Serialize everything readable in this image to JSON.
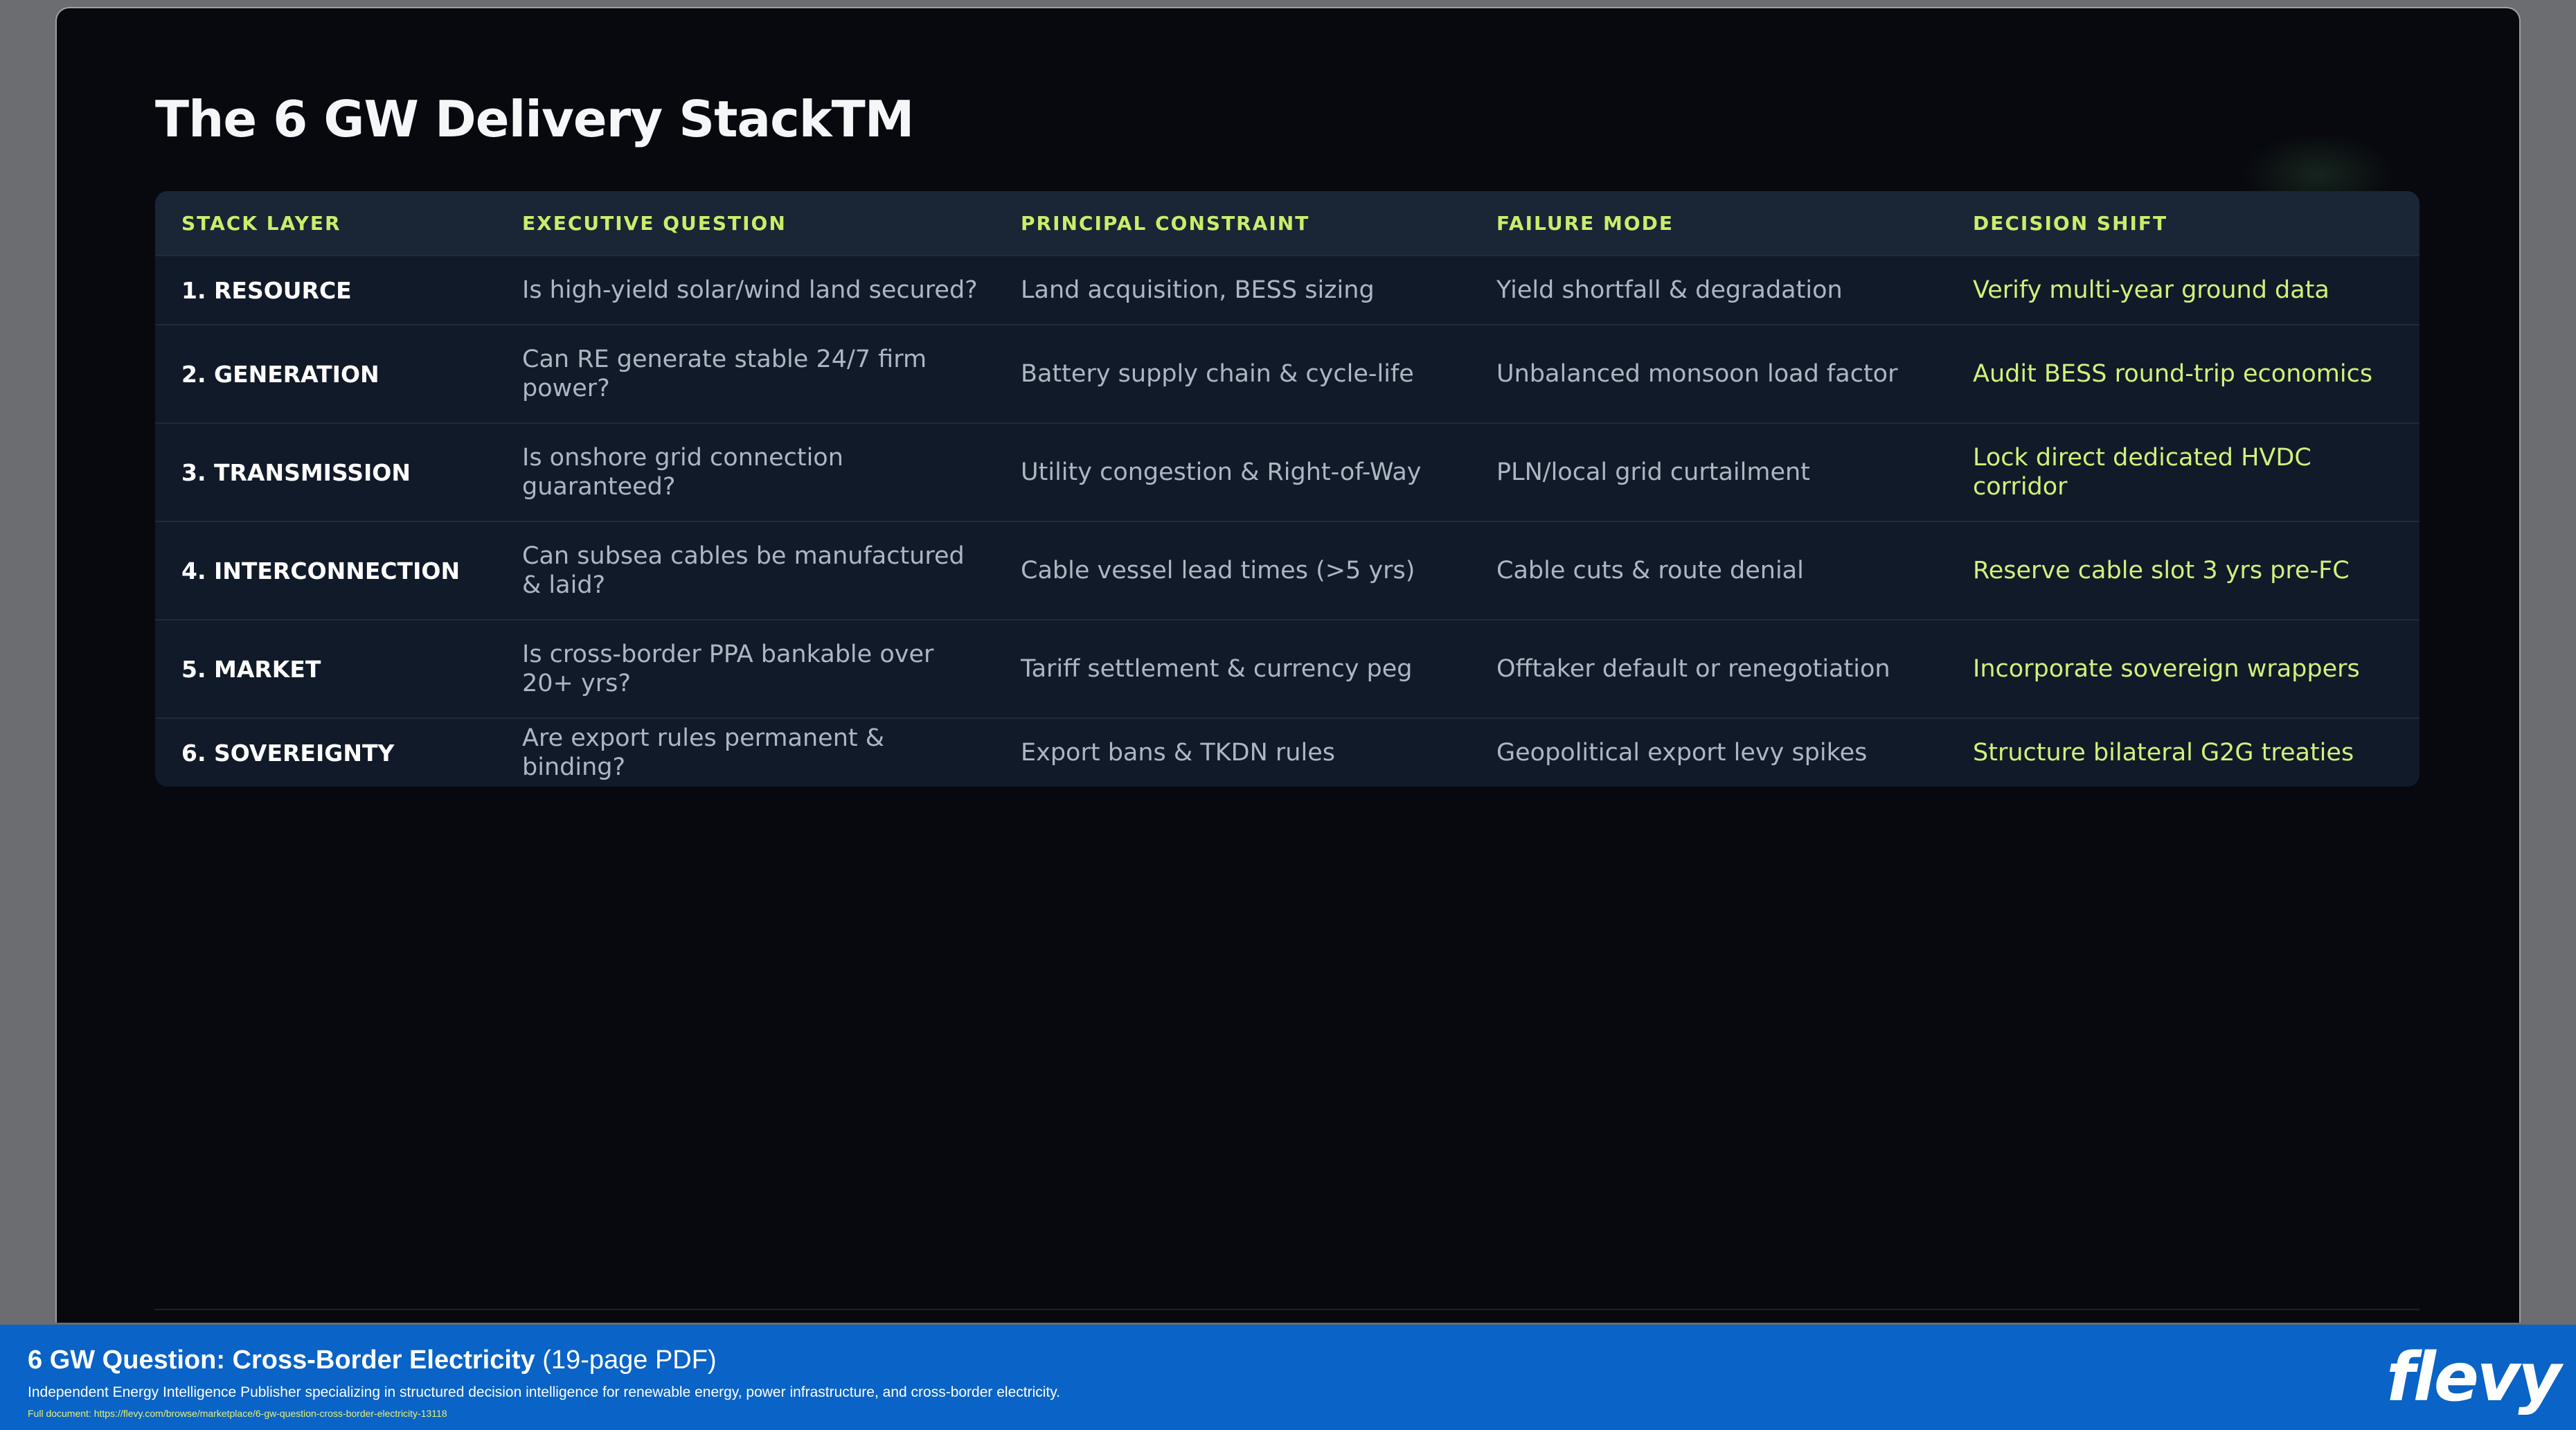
{
  "slide": {
    "title": "The 6 GW Delivery StackTM"
  },
  "table": {
    "headers": [
      "STACK LAYER",
      "EXECUTIVE QUESTION",
      "PRINCIPAL CONSTRAINT",
      "FAILURE MODE",
      "DECISION SHIFT"
    ],
    "rows": [
      [
        "1. RESOURCE",
        "Is high-yield solar/wind land secured?",
        "Land acquisition, BESS sizing",
        "Yield shortfall & degradation",
        "Verify multi-year ground data"
      ],
      [
        "2. GENERATION",
        "Can RE generate stable 24/7 firm power?",
        "Battery supply chain & cycle-life",
        "Unbalanced monsoon load factor",
        "Audit BESS round-trip economics"
      ],
      [
        "3. TRANSMISSION",
        "Is onshore grid connection guaranteed?",
        "Utility congestion & Right-of-Way",
        "PLN/local grid curtailment",
        "Lock direct dedicated HVDC corridor"
      ],
      [
        "4. INTERCONNECTION",
        "Can subsea cables be manufactured & laid?",
        "Cable vessel lead times (>5 yrs)",
        "Cable cuts & route denial",
        "Reserve cable slot 3 yrs pre-FC"
      ],
      [
        "5. MARKET",
        "Is cross-border PPA bankable over 20+ yrs?",
        "Tariff settlement & currency peg",
        "Offtaker default or renegotiation",
        "Incorporate sovereign wrappers"
      ],
      [
        "6. SOVEREIGNTY",
        "Are export rules permanent & binding?",
        "Export bans & TKDN rules",
        "Geopolitical export levy spikes",
        "Structure bilateral G2G treaties"
      ]
    ]
  },
  "banner": {
    "title_strong": "6 GW Question: Cross-Border Electricity",
    "title_suffix": " (19-page PDF)",
    "description": "Independent Energy Intelligence Publisher specializing in structured decision intelligence for renewable energy, power infrastructure, and cross-border electricity.",
    "url": "Full document: https://flevy.com/browse/marketplace/6-gw-question-cross-border-electricity-13118",
    "logo": "flevy"
  },
  "colors": {
    "background": "#07090f",
    "table_bg": "#111a29",
    "header_bg": "#1a2536",
    "accent_green": "#c9ee6a",
    "banner_blue": "#0a63c6"
  }
}
